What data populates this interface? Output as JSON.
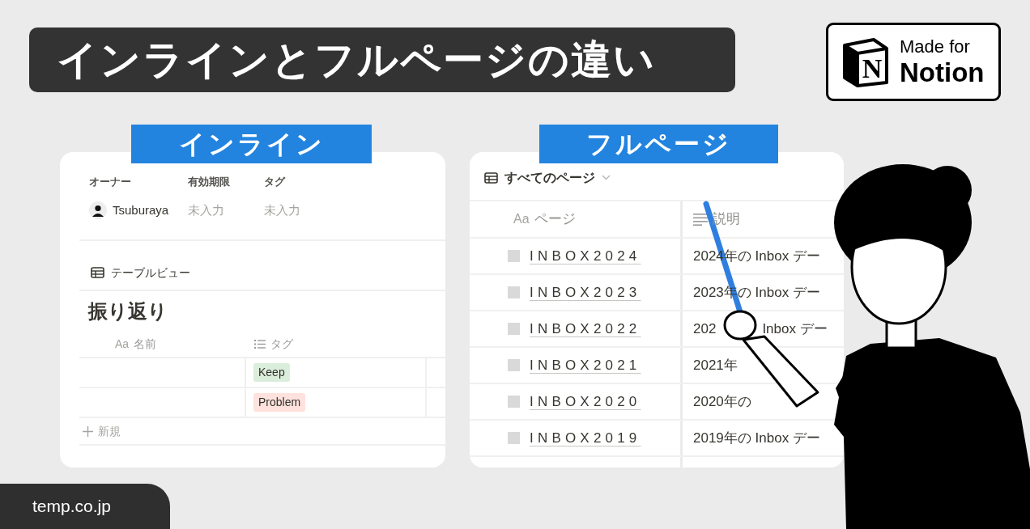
{
  "title": "インラインとフルページの違い",
  "badge": {
    "line1": "Made for",
    "line2": "Notion",
    "logo_letter": "N"
  },
  "inline": {
    "label": "インライン",
    "properties": [
      {
        "name": "オーナー",
        "value": "Tsuburaya",
        "kind": "person"
      },
      {
        "name": "有効期限",
        "value": "未入力",
        "kind": "empty"
      },
      {
        "name": "タグ",
        "value": "未入力",
        "kind": "empty"
      }
    ],
    "view_name": "テーブルビュー",
    "database_title": "振り返り",
    "columns": [
      {
        "prefix": "Aa",
        "name": "名前",
        "kind": "title"
      },
      {
        "name": "タグ",
        "kind": "multi_select"
      }
    ],
    "rows": [
      {
        "tag": "Keep",
        "color": "#dbeddb"
      },
      {
        "tag": "Problem",
        "color": "#ffe2dd"
      }
    ],
    "new_label": "新規"
  },
  "fullpage": {
    "label": "フルページ",
    "view_name": "すべてのページ",
    "columns": [
      {
        "prefix": "Aa",
        "name": "ページ",
        "kind": "title"
      },
      {
        "name": "説明",
        "kind": "text"
      }
    ],
    "rows": [
      {
        "name": "INBOX2024",
        "description": [
          "2024年の Inbox デー"
        ]
      },
      {
        "name": "INBOX2023",
        "description": [
          "2023年の Inbox デー"
        ]
      },
      {
        "name": "INBOX2022",
        "description": [
          "202",
          "Inbox デー"
        ]
      },
      {
        "name": "INBOX2021",
        "description": [
          "2021年"
        ]
      },
      {
        "name": "INBOX2020",
        "description": [
          "2020年の"
        ]
      },
      {
        "name": "INBOX2019",
        "description": [
          "2019年の Inbox デー"
        ]
      }
    ]
  },
  "footer": "temp.co.jp"
}
